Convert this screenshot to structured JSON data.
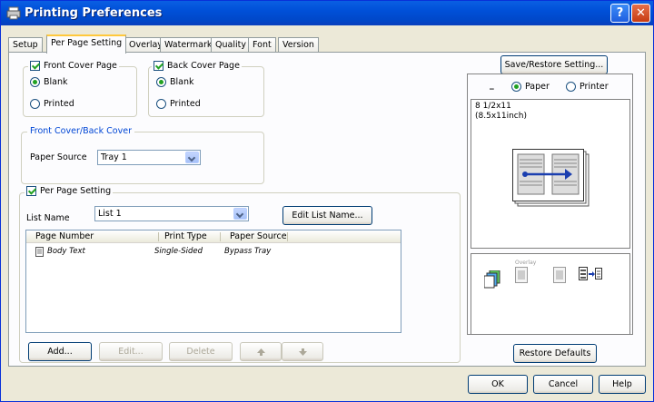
{
  "window": {
    "title": "Printing Preferences"
  },
  "tabs": [
    "Setup",
    "Per Page Setting",
    "Overlay",
    "Watermark",
    "Quality",
    "Font",
    "Version"
  ],
  "cover": {
    "front_label": "Front Cover Page",
    "back_label": "Back Cover Page",
    "front_blank": "Blank",
    "front_printed": "Printed",
    "back_blank": "Blank",
    "back_printed": "Printed",
    "source_group": "Front Cover/Back Cover",
    "paper_source_label": "Paper Source",
    "paper_source_value": "Tray 1"
  },
  "perpage": {
    "group_label": "Per Page Setting",
    "list_name_label": "List Name",
    "list_name_value": "List 1",
    "edit_list_button": "Edit List Name...",
    "columns": [
      "Page Number",
      "Print Type",
      "Paper Source"
    ],
    "rows": [
      {
        "page": "Body Text",
        "type": "Single-Sided",
        "source": "Bypass Tray"
      }
    ],
    "add_button": "Add...",
    "edit_button": "Edit...",
    "delete_button": "Delete",
    "up_icon": "arrow-up-icon",
    "down_icon": "arrow-down-icon"
  },
  "right": {
    "save_restore_button": "Save/Restore Setting...",
    "view_paper": "Paper",
    "view_printer": "Printer",
    "paper_size_line1": "8 1/2x11",
    "paper_size_line2": "(8.5x11inch)",
    "overlay_label": "Overlay",
    "restore_defaults_button": "Restore Defaults"
  },
  "footer": {
    "ok": "OK",
    "cancel": "Cancel",
    "help": "Help"
  },
  "colors": {
    "titlebar": "#0050d8",
    "accent": "#0046d5",
    "tab_highlight": "#ffc83c"
  }
}
